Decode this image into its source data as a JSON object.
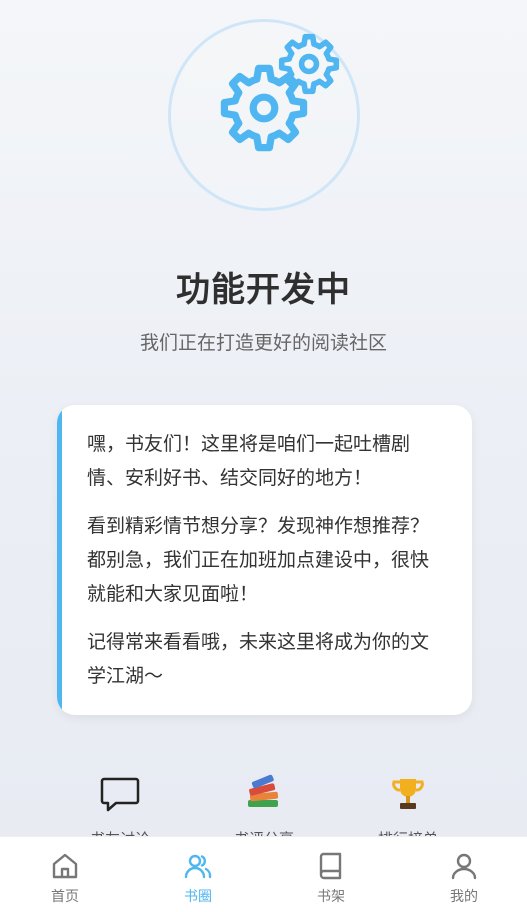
{
  "hero": {
    "title": "功能开发中",
    "subtitle": "我们正在打造更好的阅读社区",
    "icon": "gears-icon",
    "accent_color": "#4fb6f1"
  },
  "card": {
    "paragraphs": [
      "嘿，书友们！这里将是咱们一起吐槽剧情、安利好书、结交同好的地方！",
      "看到精彩情节想分享？发现神作想推荐？都别急，我们正在加班加点建设中，很快就能和大家见面啦！",
      "记得常来看看哦，未来这里将成为你的文学江湖～"
    ]
  },
  "features": [
    {
      "icon": "speech-bubble-icon",
      "label": "书友讨论"
    },
    {
      "icon": "books-icon",
      "label": "书评分享"
    },
    {
      "icon": "trophy-icon",
      "label": "排行榜单"
    }
  ],
  "nav": {
    "items": [
      {
        "icon": "home-icon",
        "label": "首页"
      },
      {
        "icon": "people-icon",
        "label": "书圈"
      },
      {
        "icon": "book-icon",
        "label": "书架"
      },
      {
        "icon": "user-icon",
        "label": "我的"
      }
    ],
    "active": "书圈",
    "active_color": "#4fb6f1",
    "inactive_color": "#777777"
  }
}
